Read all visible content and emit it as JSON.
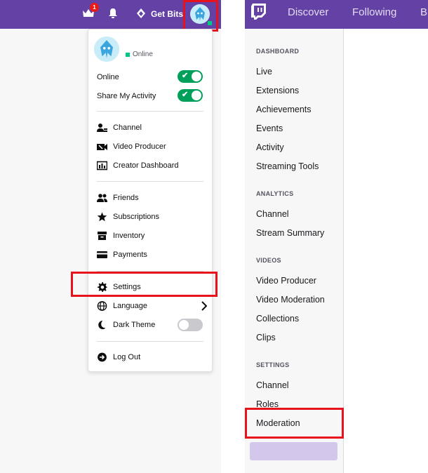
{
  "left_panel": {
    "top_bar": {
      "notification_count": "1",
      "get_bits_label": "Get Bits",
      "icons": [
        "crown-icon",
        "bell-icon",
        "bits-icon",
        "avatar"
      ]
    },
    "menu": {
      "status_text": "Online",
      "toggles": [
        {
          "label": "Online",
          "on": true
        },
        {
          "label": "Share My Activity",
          "on": true
        }
      ],
      "group1": [
        {
          "label": "Channel",
          "icon": "channel-icon"
        },
        {
          "label": "Video Producer",
          "icon": "video-producer-icon"
        },
        {
          "label": "Creator Dashboard",
          "icon": "dashboard-icon"
        }
      ],
      "group2": [
        {
          "label": "Friends",
          "icon": "friends-icon"
        },
        {
          "label": "Subscriptions",
          "icon": "star-icon"
        },
        {
          "label": "Inventory",
          "icon": "inventory-icon"
        },
        {
          "label": "Payments",
          "icon": "card-icon"
        }
      ],
      "group3": [
        {
          "label": "Settings",
          "icon": "gear-icon"
        },
        {
          "label": "Language",
          "icon": "globe-icon"
        },
        {
          "label": "Dark Theme",
          "icon": "moon-icon",
          "toggle_on": false
        }
      ],
      "logout_label": "Log Out"
    }
  },
  "right_panel": {
    "nav_tabs": [
      "Discover",
      "Following",
      "B"
    ],
    "sections": [
      {
        "heading": "DASHBOARD",
        "items": [
          "Live",
          "Extensions",
          "Achievements",
          "Events",
          "Activity",
          "Streaming Tools"
        ]
      },
      {
        "heading": "ANALYTICS",
        "items": [
          "Channel",
          "Stream Summary"
        ]
      },
      {
        "heading": "VIDEOS",
        "items": [
          "Video Producer",
          "Video Moderation",
          "Collections",
          "Clips"
        ]
      },
      {
        "heading": "SETTINGS",
        "items": [
          "Channel",
          "Roles",
          "Moderation"
        ]
      }
    ],
    "active_item": "Moderation"
  },
  "colors": {
    "brand_purple": "#6441a5",
    "highlight_red": "#e8121d",
    "toggle_green": "#00a05a",
    "active_item_bg": "#d3c7ec"
  }
}
